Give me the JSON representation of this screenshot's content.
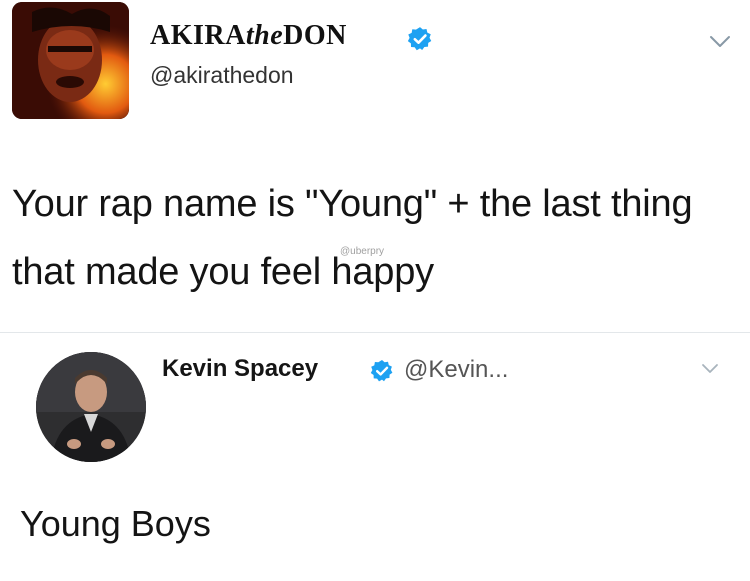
{
  "main_tweet": {
    "display_name_prefix": "AKIRA",
    "display_name_the": "the",
    "display_name_suffix": "DON",
    "handle": "@akirathedon",
    "text": "Your rap name is \"Young\" + the last thing that made you feel happy",
    "watermark": "@uberpry"
  },
  "reply_tweet": {
    "display_name": "Kevin Spacey",
    "handle": "@Kevin...",
    "text": "Young Boys"
  },
  "colors": {
    "verified_blue": "#1da1f2",
    "caret_gray": "#8899a6"
  },
  "icons": {
    "verified": "verified-badge-icon",
    "caret": "chevron-down-icon"
  }
}
